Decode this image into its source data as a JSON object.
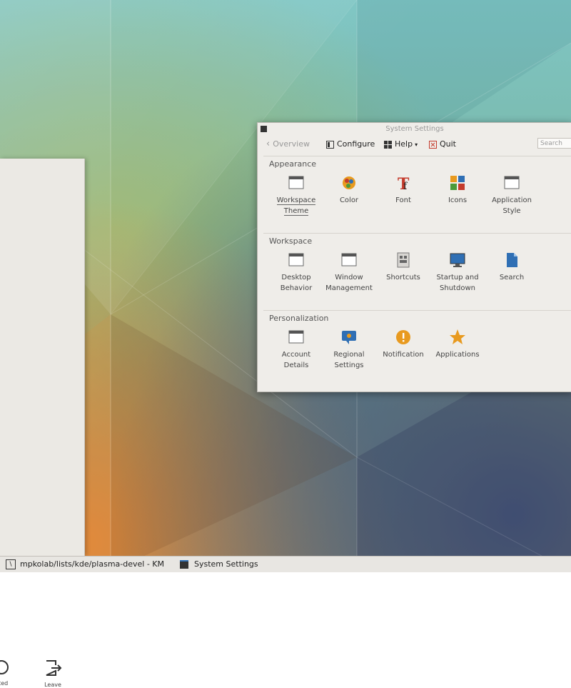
{
  "left_panel": {
    "buttons": [
      {
        "label": "tited",
        "icon": "power-icon"
      },
      {
        "label": "Leave",
        "icon": "leave-icon"
      }
    ]
  },
  "window": {
    "title": "System Settings",
    "toolbar": {
      "overview": "Overview",
      "configure": "Configure",
      "help": "Help",
      "quit": "Quit",
      "search_placeholder": "Search"
    },
    "sections": [
      {
        "title": "Appearance",
        "items": [
          {
            "label": "Workspace Theme",
            "icon": "window-icon"
          },
          {
            "label": "Color",
            "icon": "color-palette-icon"
          },
          {
            "label": "Font",
            "icon": "font-icon"
          },
          {
            "label": "Icons",
            "icon": "icons-icon"
          },
          {
            "label": "Application Style",
            "icon": "window-icon"
          }
        ]
      },
      {
        "title": "Workspace",
        "items": [
          {
            "label": "Desktop Behavior",
            "icon": "window-icon"
          },
          {
            "label": "Window Management",
            "icon": "window-icon"
          },
          {
            "label": "Shortcuts",
            "icon": "shortcuts-icon"
          },
          {
            "label": "Startup and Shutdown",
            "icon": "monitor-icon"
          },
          {
            "label": "Search",
            "icon": "document-icon"
          }
        ]
      },
      {
        "title": "Personalization",
        "items": [
          {
            "label": "Account Details",
            "icon": "window-icon"
          },
          {
            "label": "Regional Settings",
            "icon": "flag-icon"
          },
          {
            "label": "Notification",
            "icon": "notification-icon"
          },
          {
            "label": "Applications",
            "icon": "star-icon"
          }
        ]
      }
    ]
  },
  "taskbar": {
    "tasks": [
      {
        "label": "mpkolab/lists/kde/plasma-devel - KM",
        "icon": "terminal-icon"
      },
      {
        "label": "System Settings",
        "icon": "settings-icon"
      }
    ]
  },
  "colors": {
    "accent_blue": "#2f6fb4",
    "orange": "#e89a1f",
    "red": "#c43b2c"
  }
}
